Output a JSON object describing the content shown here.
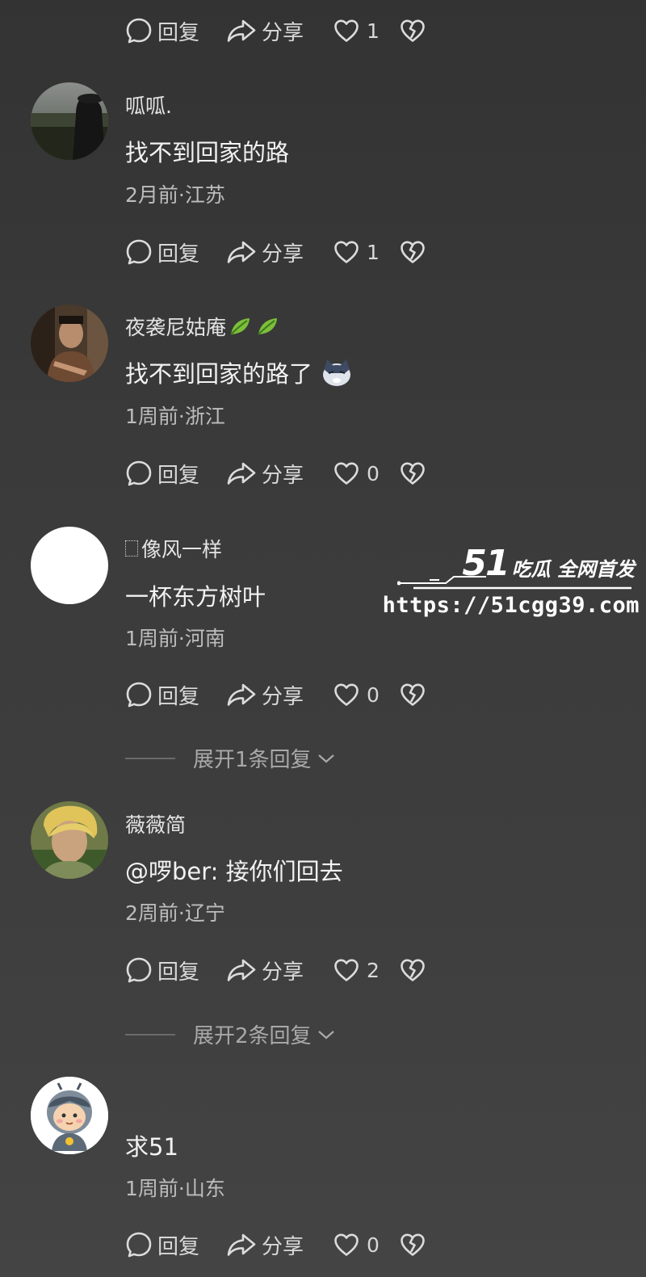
{
  "actions": {
    "reply_label": "回复",
    "share_label": "分享"
  },
  "top_actions": {
    "likes": "1"
  },
  "comments": [
    {
      "username": "呱呱.",
      "text": "找不到回家的路",
      "meta": "2月前·江苏",
      "likes": "1"
    },
    {
      "username": "夜袭尼姑庵",
      "text": "找不到回家的路了",
      "meta": "1周前·浙江",
      "likes": "0"
    },
    {
      "username": "像风一样",
      "text": "一杯东方树叶",
      "meta": "1周前·河南",
      "likes": "0",
      "expand_label": "展开1条回复"
    },
    {
      "username": "薇薇简",
      "text": "@啰ber: 接你们回去",
      "meta": "2周前·辽宁",
      "likes": "2",
      "expand_label": "展开2条回复"
    },
    {
      "username": "",
      "text": "求51",
      "meta": "1周前·山东",
      "likes": "0"
    }
  ],
  "watermark": {
    "number": "51",
    "text": "吃瓜 全网首发",
    "url": "https://51cgg39.com"
  },
  "colors": {
    "background": "#3a3a3a",
    "text_primary": "#f2f2f2",
    "text_secondary": "#bdbdbd"
  },
  "icons": [
    "comment-icon",
    "share-icon",
    "heart-icon",
    "broken-heart-icon",
    "chevron-down-icon",
    "leaf-emoji-icon",
    "cat-emoji-icon"
  ]
}
